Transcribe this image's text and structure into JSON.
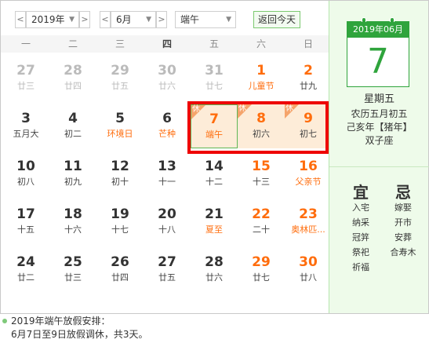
{
  "toolbar": {
    "prev_year": "<",
    "year": "2019年",
    "next_year": ">",
    "prev_month": "<",
    "month": "6月",
    "next_month": ">",
    "holiday": "端午",
    "today_button": "返回今天"
  },
  "weekdays": [
    "一",
    "二",
    "三",
    "四",
    "五",
    "六",
    "日"
  ],
  "holiday_tag": "休",
  "days": [
    {
      "num": "27",
      "lunar": "廿三",
      "state": "other"
    },
    {
      "num": "28",
      "lunar": "廿四",
      "state": "other"
    },
    {
      "num": "29",
      "lunar": "廿五",
      "state": "other"
    },
    {
      "num": "30",
      "lunar": "廿六",
      "state": "other"
    },
    {
      "num": "31",
      "lunar": "廿七",
      "state": "other"
    },
    {
      "num": "1",
      "lunar": "儿童节",
      "state": "weekend",
      "festival": true
    },
    {
      "num": "2",
      "lunar": "廿九",
      "state": "weekend"
    },
    {
      "num": "3",
      "lunar": "五月大",
      "state": "normal"
    },
    {
      "num": "4",
      "lunar": "初二",
      "state": "normal"
    },
    {
      "num": "5",
      "lunar": "环境日",
      "state": "normal",
      "festival": true
    },
    {
      "num": "6",
      "lunar": "芒种",
      "state": "normal",
      "festival": true
    },
    {
      "num": "7",
      "lunar": "端午",
      "state": "selected",
      "festival": true
    },
    {
      "num": "8",
      "lunar": "初六",
      "state": "holiday"
    },
    {
      "num": "9",
      "lunar": "初七",
      "state": "holiday"
    },
    {
      "num": "10",
      "lunar": "初八",
      "state": "normal"
    },
    {
      "num": "11",
      "lunar": "初九",
      "state": "normal"
    },
    {
      "num": "12",
      "lunar": "初十",
      "state": "normal"
    },
    {
      "num": "13",
      "lunar": "十一",
      "state": "normal"
    },
    {
      "num": "14",
      "lunar": "十二",
      "state": "normal"
    },
    {
      "num": "15",
      "lunar": "十三",
      "state": "weekend"
    },
    {
      "num": "16",
      "lunar": "父亲节",
      "state": "weekend",
      "festival": true
    },
    {
      "num": "17",
      "lunar": "十五",
      "state": "normal"
    },
    {
      "num": "18",
      "lunar": "十六",
      "state": "normal"
    },
    {
      "num": "19",
      "lunar": "十七",
      "state": "normal"
    },
    {
      "num": "20",
      "lunar": "十八",
      "state": "normal"
    },
    {
      "num": "21",
      "lunar": "夏至",
      "state": "normal",
      "festival": true
    },
    {
      "num": "22",
      "lunar": "二十",
      "state": "weekend"
    },
    {
      "num": "23",
      "lunar": "奥林匹...",
      "state": "weekend",
      "festival": true
    },
    {
      "num": "24",
      "lunar": "廿二",
      "state": "normal"
    },
    {
      "num": "25",
      "lunar": "廿三",
      "state": "normal"
    },
    {
      "num": "26",
      "lunar": "廿四",
      "state": "normal"
    },
    {
      "num": "27",
      "lunar": "廿五",
      "state": "normal"
    },
    {
      "num": "28",
      "lunar": "廿六",
      "state": "normal"
    },
    {
      "num": "29",
      "lunar": "廿七",
      "state": "weekend"
    },
    {
      "num": "30",
      "lunar": "廿八",
      "state": "weekend"
    }
  ],
  "detail": {
    "header": "2019年06月",
    "day": "7",
    "weekday": "星期五",
    "lunar": "农历五月初五",
    "ganzhi": "己亥年【猪年】",
    "zodiac": "双子座",
    "yi_title": "宜",
    "ji_title": "忌",
    "yi": [
      "入宅",
      "纳采",
      "冠笄",
      "祭祀",
      "祈福"
    ],
    "ji": [
      "嫁娶",
      "开市",
      "安葬",
      "合寿木"
    ]
  },
  "footer": {
    "line1": "2019年端午放假安排：",
    "line2": "6月7日至9日放假调休，共3天。"
  },
  "colors": {
    "accent_green": "#2fa43c",
    "holiday_orange": "#ff6d0d",
    "highlight_red": "#ee0000",
    "holiday_bg": "#fdecd8"
  }
}
